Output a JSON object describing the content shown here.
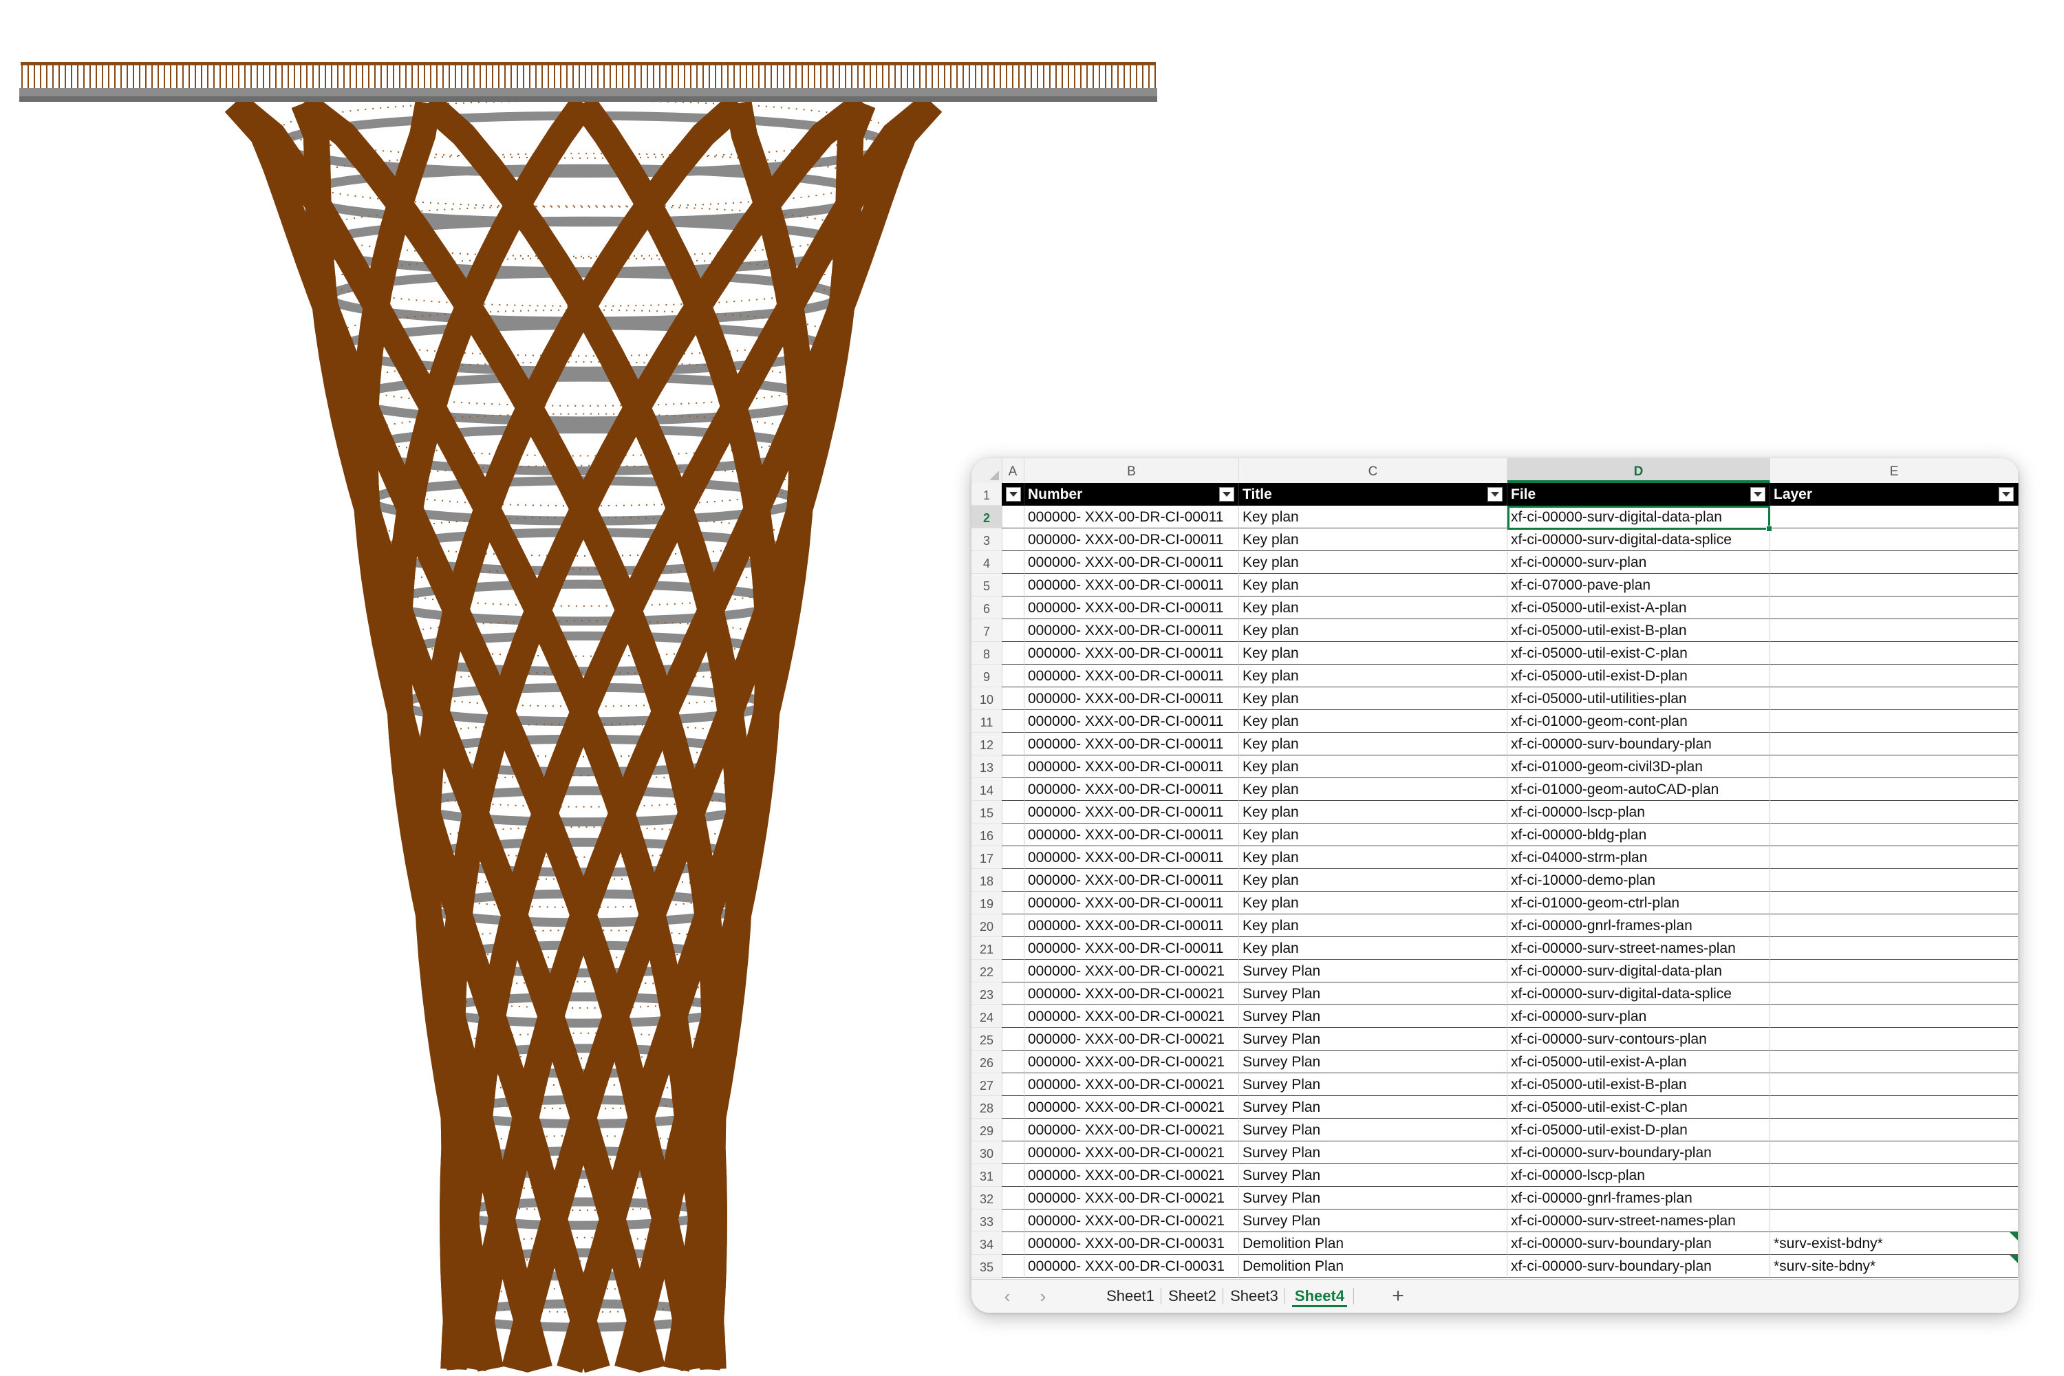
{
  "colors": {
    "timber": "#7a3d08",
    "deck": "#8a8a8a",
    "excel_green": "#107c41",
    "header_black": "#000000"
  },
  "spreadsheet": {
    "columns": [
      "A",
      "B",
      "C",
      "D",
      "E"
    ],
    "active_column": "D",
    "header": {
      "number": "Number",
      "title": "Title",
      "file": "File",
      "layer": "Layer"
    },
    "selected_cell": "D2",
    "rows": [
      {
        "n": "2",
        "number": "000000- XXX-00-DR-CI-00011",
        "title": "Key plan",
        "file": "xf-ci-00000-surv-digital-data-plan",
        "layer": ""
      },
      {
        "n": "3",
        "number": "000000- XXX-00-DR-CI-00011",
        "title": "Key plan",
        "file": "xf-ci-00000-surv-digital-data-splice",
        "layer": ""
      },
      {
        "n": "4",
        "number": "000000- XXX-00-DR-CI-00011",
        "title": "Key plan",
        "file": "xf-ci-00000-surv-plan",
        "layer": ""
      },
      {
        "n": "5",
        "number": "000000- XXX-00-DR-CI-00011",
        "title": "Key plan",
        "file": "xf-ci-07000-pave-plan",
        "layer": ""
      },
      {
        "n": "6",
        "number": "000000- XXX-00-DR-CI-00011",
        "title": "Key plan",
        "file": "xf-ci-05000-util-exist-A-plan",
        "layer": ""
      },
      {
        "n": "7",
        "number": "000000- XXX-00-DR-CI-00011",
        "title": "Key plan",
        "file": "xf-ci-05000-util-exist-B-plan",
        "layer": ""
      },
      {
        "n": "8",
        "number": "000000- XXX-00-DR-CI-00011",
        "title": "Key plan",
        "file": "xf-ci-05000-util-exist-C-plan",
        "layer": ""
      },
      {
        "n": "9",
        "number": "000000- XXX-00-DR-CI-00011",
        "title": "Key plan",
        "file": "xf-ci-05000-util-exist-D-plan",
        "layer": ""
      },
      {
        "n": "10",
        "number": "000000- XXX-00-DR-CI-00011",
        "title": "Key plan",
        "file": "xf-ci-05000-util-utilities-plan",
        "layer": ""
      },
      {
        "n": "11",
        "number": "000000- XXX-00-DR-CI-00011",
        "title": "Key plan",
        "file": "xf-ci-01000-geom-cont-plan",
        "layer": ""
      },
      {
        "n": "12",
        "number": "000000- XXX-00-DR-CI-00011",
        "title": "Key plan",
        "file": "xf-ci-00000-surv-boundary-plan",
        "layer": ""
      },
      {
        "n": "13",
        "number": "000000- XXX-00-DR-CI-00011",
        "title": "Key plan",
        "file": "xf-ci-01000-geom-civil3D-plan",
        "layer": ""
      },
      {
        "n": "14",
        "number": "000000- XXX-00-DR-CI-00011",
        "title": "Key plan",
        "file": "xf-ci-01000-geom-autoCAD-plan",
        "layer": ""
      },
      {
        "n": "15",
        "number": "000000- XXX-00-DR-CI-00011",
        "title": "Key plan",
        "file": "xf-ci-00000-lscp-plan",
        "layer": ""
      },
      {
        "n": "16",
        "number": "000000- XXX-00-DR-CI-00011",
        "title": "Key plan",
        "file": "xf-ci-00000-bldg-plan",
        "layer": ""
      },
      {
        "n": "17",
        "number": "000000- XXX-00-DR-CI-00011",
        "title": "Key plan",
        "file": "xf-ci-04000-strm-plan",
        "layer": ""
      },
      {
        "n": "18",
        "number": "000000- XXX-00-DR-CI-00011",
        "title": "Key plan",
        "file": "xf-ci-10000-demo-plan",
        "layer": ""
      },
      {
        "n": "19",
        "number": "000000- XXX-00-DR-CI-00011",
        "title": "Key plan",
        "file": "xf-ci-01000-geom-ctrl-plan",
        "layer": ""
      },
      {
        "n": "20",
        "number": "000000- XXX-00-DR-CI-00011",
        "title": "Key plan",
        "file": "xf-ci-00000-gnrl-frames-plan",
        "layer": ""
      },
      {
        "n": "21",
        "number": "000000- XXX-00-DR-CI-00011",
        "title": "Key plan",
        "file": "xf-ci-00000-surv-street-names-plan",
        "layer": ""
      },
      {
        "n": "22",
        "number": "000000- XXX-00-DR-CI-00021",
        "title": "Survey Plan",
        "file": "xf-ci-00000-surv-digital-data-plan",
        "layer": ""
      },
      {
        "n": "23",
        "number": "000000- XXX-00-DR-CI-00021",
        "title": "Survey Plan",
        "file": "xf-ci-00000-surv-digital-data-splice",
        "layer": ""
      },
      {
        "n": "24",
        "number": "000000- XXX-00-DR-CI-00021",
        "title": "Survey Plan",
        "file": "xf-ci-00000-surv-plan",
        "layer": ""
      },
      {
        "n": "25",
        "number": "000000- XXX-00-DR-CI-00021",
        "title": "Survey Plan",
        "file": "xf-ci-00000-surv-contours-plan",
        "layer": ""
      },
      {
        "n": "26",
        "number": "000000- XXX-00-DR-CI-00021",
        "title": "Survey Plan",
        "file": "xf-ci-05000-util-exist-A-plan",
        "layer": ""
      },
      {
        "n": "27",
        "number": "000000- XXX-00-DR-CI-00021",
        "title": "Survey Plan",
        "file": "xf-ci-05000-util-exist-B-plan",
        "layer": ""
      },
      {
        "n": "28",
        "number": "000000- XXX-00-DR-CI-00021",
        "title": "Survey Plan",
        "file": "xf-ci-05000-util-exist-C-plan",
        "layer": ""
      },
      {
        "n": "29",
        "number": "000000- XXX-00-DR-CI-00021",
        "title": "Survey Plan",
        "file": "xf-ci-05000-util-exist-D-plan",
        "layer": ""
      },
      {
        "n": "30",
        "number": "000000- XXX-00-DR-CI-00021",
        "title": "Survey Plan",
        "file": "xf-ci-00000-surv-boundary-plan",
        "layer": ""
      },
      {
        "n": "31",
        "number": "000000- XXX-00-DR-CI-00021",
        "title": "Survey Plan",
        "file": "xf-ci-00000-lscp-plan",
        "layer": ""
      },
      {
        "n": "32",
        "number": "000000- XXX-00-DR-CI-00021",
        "title": "Survey Plan",
        "file": "xf-ci-00000-gnrl-frames-plan",
        "layer": ""
      },
      {
        "n": "33",
        "number": "000000- XXX-00-DR-CI-00021",
        "title": "Survey Plan",
        "file": "xf-ci-00000-surv-street-names-plan",
        "layer": ""
      },
      {
        "n": "34",
        "number": "000000- XXX-00-DR-CI-00031",
        "title": "Demolition Plan",
        "file": "xf-ci-00000-surv-boundary-plan",
        "layer": "*surv-exist-bdny*"
      },
      {
        "n": "35",
        "number": "000000- XXX-00-DR-CI-00031",
        "title": "Demolition Plan",
        "file": "xf-ci-00000-surv-boundary-plan",
        "layer": "*surv-site-bdny*"
      }
    ],
    "tabs": [
      "Sheet1",
      "Sheet2",
      "Sheet3",
      "Sheet4"
    ],
    "active_tab": "Sheet4",
    "nav": {
      "prev": "‹",
      "next": "›",
      "add": "+"
    }
  }
}
